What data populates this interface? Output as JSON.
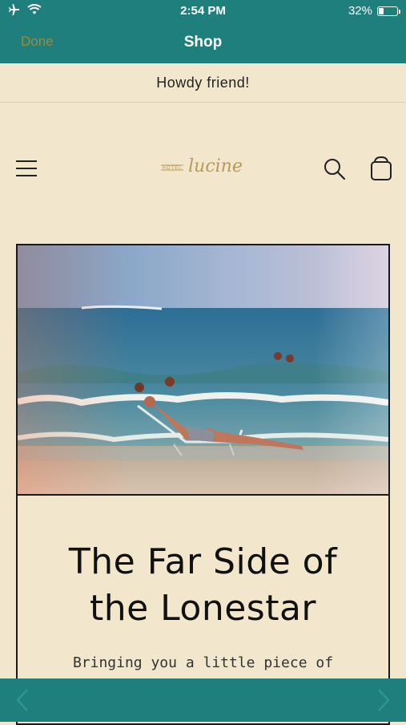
{
  "status": {
    "time": "2:54 PM",
    "battery": "32%",
    "battery_level": 0.32
  },
  "navbar": {
    "done": "Done",
    "title": "Shop"
  },
  "announcement": "Howdy friend!",
  "header": {
    "logo_small": "HOTEL",
    "logo_script": "lucine"
  },
  "card": {
    "title_line1": "The Far Side of",
    "title_line2": "the Lonestar",
    "subtitle": "Bringing you a little piece of"
  },
  "colors": {
    "bar": "#1e7f7c",
    "background": "#f2e6cc",
    "done": "#a08a3b",
    "logo": "#b89a55"
  }
}
